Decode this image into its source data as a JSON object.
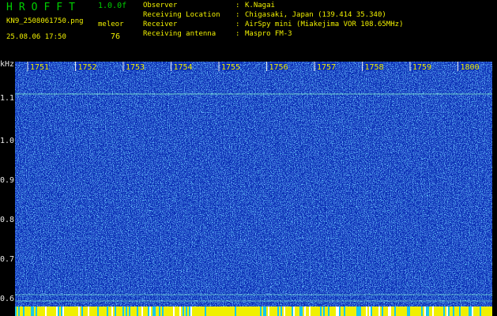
{
  "header": {
    "app_title": "HROFFT",
    "version": "1.0.0f",
    "file_name": "KN9_2508061750.png",
    "mode": "meleor",
    "date_time": "25.08.06 17:50",
    "count": "76",
    "meta": [
      {
        "key": "Observer",
        "value": "K.Nagai"
      },
      {
        "key": "Receiving Location",
        "value": "Chigasaki, Japan (139.414 35.340)"
      },
      {
        "key": "Receiver",
        "value": "AirSpy mini (Miakejima VOR 108.65MHz)"
      },
      {
        "key": "Receiving antenna",
        "value": "Maspro FM-3"
      }
    ],
    "separator": ":"
  },
  "spectrogram": {
    "unit": "kHz",
    "time_ticks": [
      "1751",
      "1752",
      "1753",
      "1754",
      "1755",
      "1756",
      "1757",
      "1758",
      "1759",
      "1800"
    ],
    "freq_ticks": [
      "1.1",
      "1.0",
      "0.9",
      "0.8",
      "0.7",
      "0.6"
    ],
    "colors": {
      "background": "#0a2eb4",
      "noise_low": "#1f5cff",
      "noise_mid": "#19c8e6",
      "noise_high": "#9dfbe0",
      "bottom_band": "#f0f000"
    }
  }
}
